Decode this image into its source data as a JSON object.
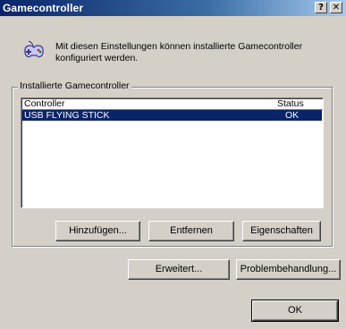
{
  "window": {
    "title": "Gamecontroller",
    "help_glyph": "?",
    "close_glyph": "✕"
  },
  "header": {
    "icon": "gamepad-icon",
    "description": "Mit diesen Einstellungen können installierte Gamecontroller konfiguriert werden."
  },
  "group": {
    "label": "Installierte Gamecontroller"
  },
  "list": {
    "columns": [
      "Controller",
      "Status"
    ],
    "rows": [
      {
        "controller": "USB FLYING STICK",
        "status": "OK",
        "selected": true
      }
    ]
  },
  "buttons": {
    "add": "Hinzufügen...",
    "remove": "Entfernen",
    "properties": "Eigenschaften",
    "advanced": "Erweitert...",
    "troubleshoot": "Problembehandlung...",
    "ok": "OK"
  },
  "colors": {
    "title_gradient_start": "#0a246a",
    "title_gradient_end": "#a6caf0",
    "face": "#d4d0c8",
    "selection": "#0a246a"
  }
}
